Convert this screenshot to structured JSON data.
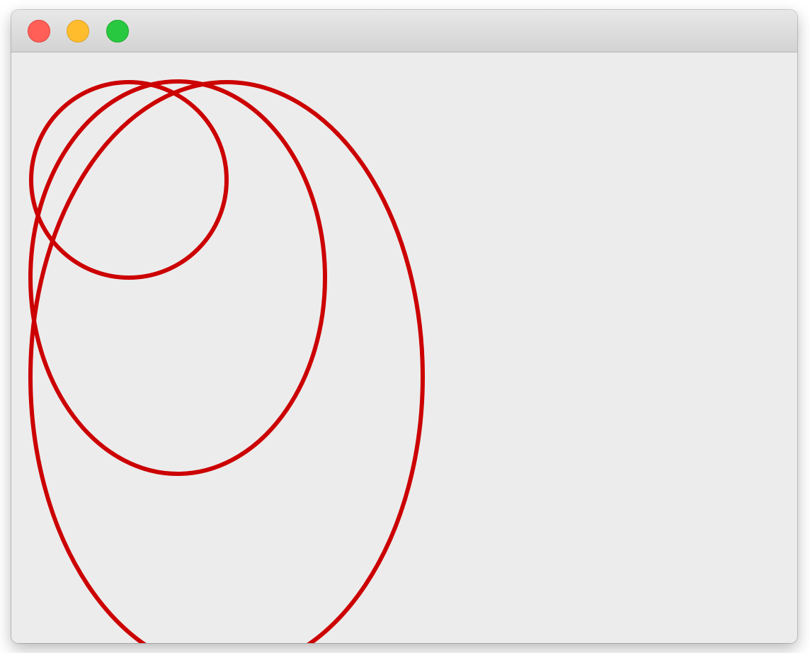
{
  "window": {
    "buttons": {
      "close": "close-button",
      "minimize": "minimize-button",
      "zoom": "zoom-button"
    },
    "colors": {
      "close": "#ff5f57",
      "minimize": "#ffbd2e",
      "zoom": "#28c940",
      "content_background": "#ececec"
    }
  },
  "drawing": {
    "stroke_color": "#cc0000",
    "shapes": [
      "ellipse",
      "ellipse",
      "ellipse"
    ]
  }
}
